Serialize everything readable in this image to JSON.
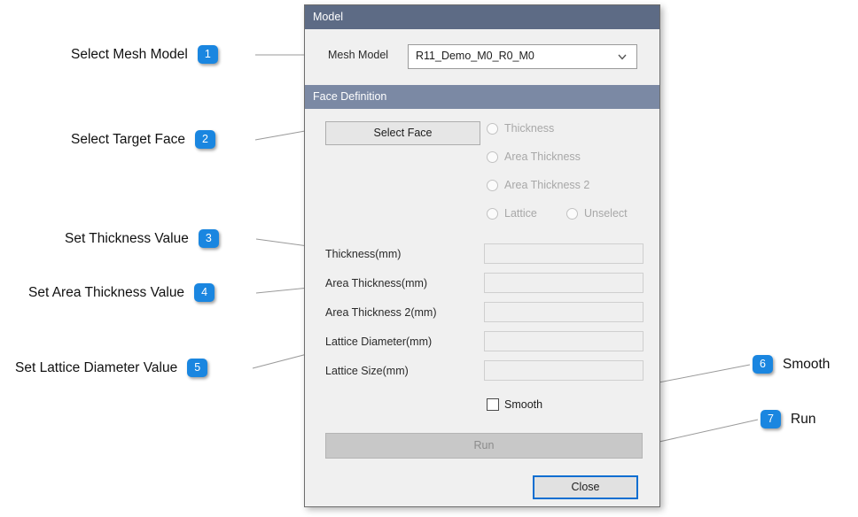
{
  "dialog": {
    "sections": {
      "model": {
        "title": "Model",
        "mesh_model_label": "Mesh Model",
        "mesh_model_value": "R11_Demo_M0_R0_M0",
        "dropdown_icon": "chevron-down-icon"
      },
      "face_definition": {
        "title": "Face Definition",
        "select_face_button": "Select Face",
        "radios": [
          {
            "label": "Thickness",
            "checked": false,
            "disabled": true
          },
          {
            "label": "Area Thickness",
            "checked": false,
            "disabled": true
          },
          {
            "label": "Area Thickness 2",
            "checked": false,
            "disabled": true
          },
          {
            "label": "Lattice",
            "checked": false,
            "disabled": true
          },
          {
            "label": "Unselect",
            "checked": false,
            "disabled": true
          }
        ],
        "fields": [
          {
            "label": "Thickness(mm)",
            "value": "",
            "placeholder": ""
          },
          {
            "label": "Area Thickness(mm)",
            "value": "",
            "placeholder": ""
          },
          {
            "label": "Area Thickness 2(mm)",
            "value": "",
            "placeholder": ""
          },
          {
            "label": "Lattice Diameter(mm)",
            "value": "",
            "placeholder": ""
          },
          {
            "label": "Lattice Size(mm)",
            "value": "",
            "placeholder": ""
          }
        ],
        "smooth_checkbox_label": "Smooth",
        "smooth_checked": false,
        "run_button": "Run"
      }
    },
    "close_button": "Close"
  },
  "callouts": [
    {
      "number": "1",
      "text": "Select Mesh Model"
    },
    {
      "number": "2",
      "text": "Select Target Face"
    },
    {
      "number": "3",
      "text": "Set Thickness Value"
    },
    {
      "number": "4",
      "text": "Set Area Thickness Value"
    },
    {
      "number": "5",
      "text": "Set Lattice Diameter Value"
    },
    {
      "number": "6",
      "text": "Smooth"
    },
    {
      "number": "7",
      "text": "Run"
    }
  ],
  "colors": {
    "badge": "#1a86e0",
    "model_header": "#5d6b85",
    "face_header": "#7b89a4",
    "focus_border": "#0a6ed1",
    "panel": "#f0f0f0"
  }
}
